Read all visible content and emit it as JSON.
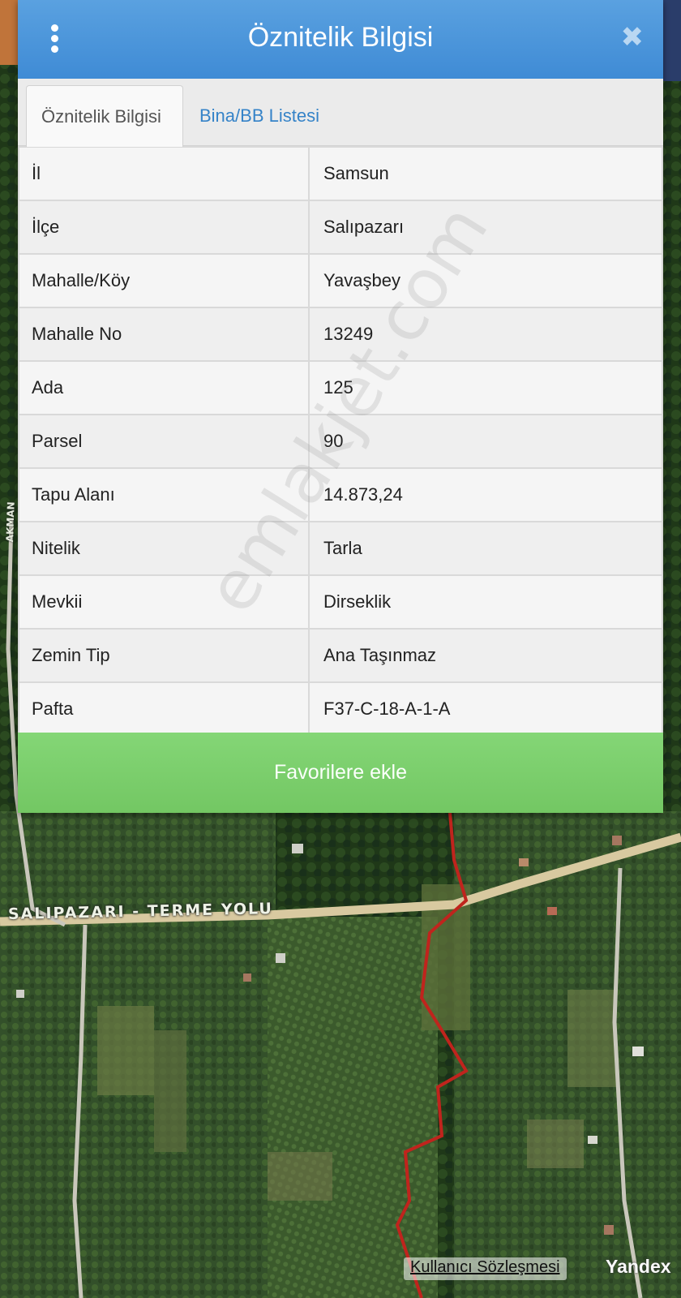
{
  "dialog": {
    "title": "Öznitelik Bilgisi",
    "menu_icon": "kebab-menu-icon",
    "close_icon": "close-icon",
    "close_glyph": "✖"
  },
  "tabs": [
    {
      "label": "Öznitelik Bilgisi",
      "active": true
    },
    {
      "label": "Bina/BB Listesi",
      "active": false
    }
  ],
  "attributes": [
    {
      "key": "İl",
      "value": "Samsun"
    },
    {
      "key": "İlçe",
      "value": "Salıpazarı"
    },
    {
      "key": "Mahalle/Köy",
      "value": "Yavaşbey"
    },
    {
      "key": "Mahalle No",
      "value": "13249"
    },
    {
      "key": "Ada",
      "value": "125"
    },
    {
      "key": "Parsel",
      "value": "90"
    },
    {
      "key": "Tapu Alanı",
      "value": "14.873,24"
    },
    {
      "key": "Nitelik",
      "value": "Tarla"
    },
    {
      "key": "Mevkii",
      "value": "Dirseklik"
    },
    {
      "key": "Zemin Tip",
      "value": "Ana Taşınmaz"
    },
    {
      "key": "Pafta",
      "value": "F37-C-18-A-1-A"
    }
  ],
  "favorite_button": {
    "label": "Favorilere ekle"
  },
  "map": {
    "road_label": "SALIPAZARI - TERME YOLU",
    "side_road_label": "AKMAN",
    "user_agreement_link": "Kullanıcı Sözleşmesi",
    "provider": "Yandex"
  },
  "watermark": "emlakjet.com",
  "colors": {
    "header": "#4a95db",
    "favorite_button": "#7dcf6e",
    "tab_link": "#3583c8",
    "boundary_line": "#c0241d"
  }
}
